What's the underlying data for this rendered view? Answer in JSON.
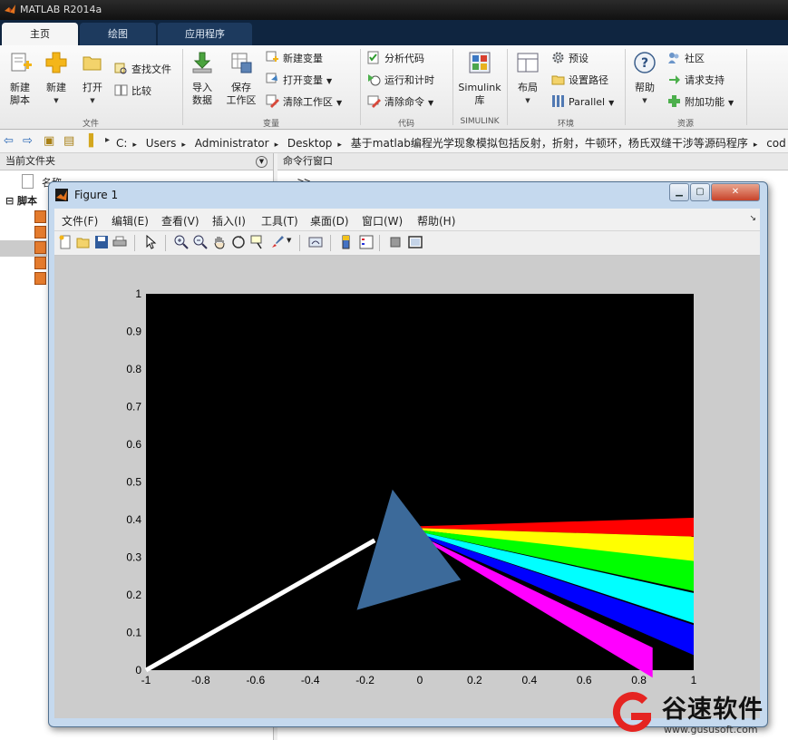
{
  "app": {
    "title": "MATLAB R2014a"
  },
  "ribbon_tabs": [
    "主页",
    "绘图",
    "应用程序"
  ],
  "ribbon": {
    "file": {
      "label": "文件",
      "new_script": "新建\n脚本",
      "new": "新建",
      "open": "打开",
      "find_files": "查找文件",
      "compare": "比较"
    },
    "variable": {
      "label": "变量",
      "import_data": "导入\n数据",
      "save_workspace": "保存\n工作区",
      "new_variable": "新建变量",
      "open_variable": "打开变量",
      "clear_workspace": "清除工作区"
    },
    "code": {
      "label": "代码",
      "analyze_code": "分析代码",
      "run_and_time": "运行和计时",
      "clear_commands": "清除命令"
    },
    "simulink": {
      "label": "SIMULINK",
      "library": "Simulink\n库"
    },
    "environment": {
      "label": "环境",
      "layout": "布局",
      "preferences": "预设",
      "set_path": "设置路径",
      "parallel": "Parallel"
    },
    "resources": {
      "label": "资源",
      "help": "帮助",
      "community": "社区",
      "request_support": "请求支持",
      "add_ons": "附加功能"
    }
  },
  "address_bar": {
    "path": [
      "C:",
      "Users",
      "Administrator",
      "Desktop",
      "基于matlab编程光学现象模拟包括反射，折射，牛顿环，杨氏双缝干涉等源码程序",
      "cod"
    ]
  },
  "current_folder": {
    "title": "当前文件夹",
    "column_name": "名称",
    "folder_label": "脚本"
  },
  "command_window": {
    "title": "命令行窗口",
    "prompt": ">> "
  },
  "figure": {
    "title": "Figure 1",
    "menu": [
      "文件(F)",
      "编辑(E)",
      "查看(V)",
      "插入(I)",
      "工具(T)",
      "桌面(D)",
      "窗口(W)",
      "帮助(H)"
    ],
    "toolbar_icons": [
      "new-figure-icon",
      "open-file-icon",
      "save-icon",
      "print-icon",
      "edit-plot-icon",
      "zoom-in-icon",
      "zoom-out-icon",
      "pan-icon",
      "rotate-3d-icon",
      "data-cursor-icon",
      "brush-icon",
      "link-plot-icon",
      "colorbar-icon",
      "legend-icon",
      "hide-plot-tools-icon",
      "show-plot-tools-icon"
    ]
  },
  "chart_data": {
    "type": "scatter",
    "title": "",
    "xlabel": "",
    "ylabel": "",
    "xlim": [
      -1,
      1
    ],
    "ylim": [
      0,
      1
    ],
    "xticks": [
      "-1",
      "-0.8",
      "-0.6",
      "-0.4",
      "-0.2",
      "0",
      "0.2",
      "0.4",
      "0.6",
      "0.8",
      "1"
    ],
    "yticks": [
      "0",
      "0.1",
      "0.2",
      "0.3",
      "0.4",
      "0.5",
      "0.6",
      "0.7",
      "0.8",
      "0.9",
      "1"
    ],
    "background": "#000000",
    "prism": {
      "color": "#3c6a9a",
      "vertices": [
        [
          -0.1,
          0.48
        ],
        [
          -0.23,
          0.16
        ],
        [
          0.15,
          0.24
        ]
      ]
    },
    "incident_ray": {
      "color": "#ffffff",
      "from": [
        -1,
        0
      ],
      "to": [
        -0.165,
        0.345
      ]
    },
    "dispersed_rays": [
      {
        "color": "#ff0000",
        "origin": [
          0,
          0.38
        ],
        "end": [
          1,
          0.38
        ],
        "end_width": 0.05
      },
      {
        "color": "#ffff00",
        "origin": [
          0,
          0.375
        ],
        "end": [
          1,
          0.32
        ],
        "end_width": 0.07
      },
      {
        "color": "#00ff00",
        "origin": [
          0,
          0.37
        ],
        "end": [
          1,
          0.25
        ],
        "end_width": 0.08
      },
      {
        "color": "#00ffff",
        "origin": [
          0,
          0.365
        ],
        "end": [
          1,
          0.165
        ],
        "end_width": 0.08
      },
      {
        "color": "#0000ff",
        "origin": [
          0,
          0.36
        ],
        "end": [
          1,
          0.08
        ],
        "end_width": 0.08
      },
      {
        "color": "#ff00ff",
        "origin": [
          0,
          0.355
        ],
        "end": [
          0.85,
          0.02
        ],
        "end_width": 0.08
      }
    ]
  },
  "watermark": {
    "brand": "谷速软件",
    "url": "www.gususoft.com"
  }
}
